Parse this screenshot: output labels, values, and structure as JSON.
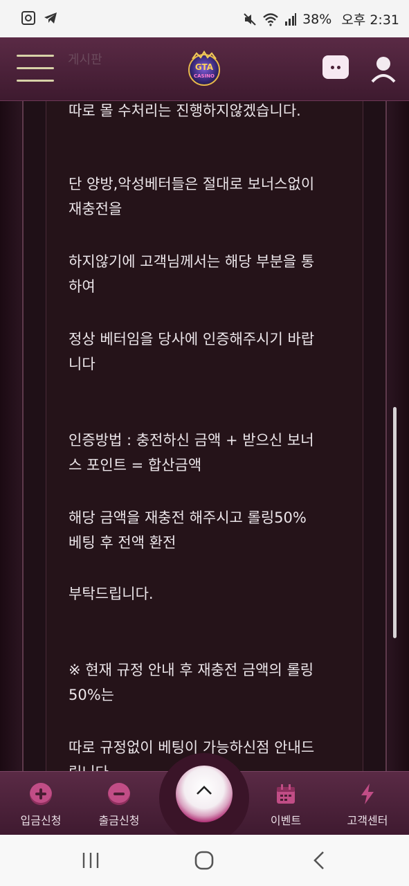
{
  "status_bar": {
    "battery": "38%",
    "time": "오후 2:31",
    "icons": [
      "screenshot-icon",
      "telegram-icon",
      "mute-icon",
      "wifi-icon",
      "signal-icon"
    ]
  },
  "header": {
    "ghost_text": "게시판",
    "logo_text": "GTA CASINO",
    "icons": [
      "hamburger-menu-icon",
      "chat-icon",
      "user-icon"
    ]
  },
  "article": {
    "paragraphs": [
      {
        "lines": [
          "따로 몰 수처리는 진행하지않겠습니다."
        ]
      },
      {
        "lines": [
          "단 양방,악성베터들은 절대로 보너스없이",
          "재충전을"
        ]
      },
      {
        "lines": [
          "하지않기에 고객님께서는 해당 부분을 통",
          "하여"
        ]
      },
      {
        "lines": [
          "정상 베터임을 당사에 인증해주시기 바랍",
          "니다"
        ]
      },
      {
        "lines": [
          "인증방법 : 충전하신 금액 + 받으신 보너",
          "스 포인트 = 합산금액"
        ]
      },
      {
        "lines": [
          "해당 금액을 재충전 해주시고 롤링50%",
          "베팅 후 전액 환전"
        ]
      },
      {
        "lines": [
          "부탁드립니다."
        ]
      },
      {
        "lines": [
          "※ 현재 규정 안내 후 재충전 금액의 롤링",
          "50%는"
        ]
      },
      {
        "lines": [
          "따로 규정없이 베팅이 가능하신점 안내드",
          "립니다"
        ]
      }
    ]
  },
  "bottom_nav": {
    "items": [
      {
        "label": "입금신청",
        "icon": "plus-circle-icon"
      },
      {
        "label": "출금신청",
        "icon": "minus-circle-icon"
      },
      {
        "label": "",
        "icon": "scroll-top-icon"
      },
      {
        "label": "이벤트",
        "icon": "calendar-icon"
      },
      {
        "label": "고객센터",
        "icon": "lightning-icon"
      }
    ]
  },
  "colors": {
    "header_bg": "#5a2a45",
    "panel_bg": "#251319",
    "accent": "#c14d86"
  }
}
